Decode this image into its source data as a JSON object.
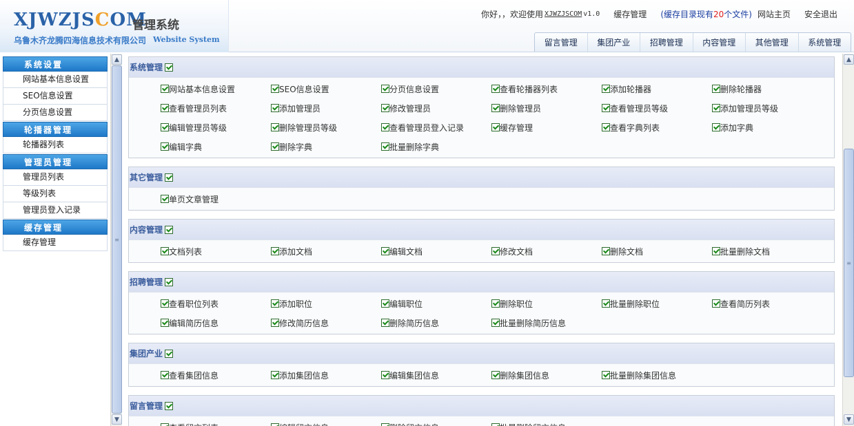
{
  "header": {
    "logo_main_a": "XJWZJS",
    "logo_main_b": "C",
    "logo_main_c": "OM",
    "logo_sub": "管理系统",
    "logo_company": "乌鲁木齐龙腾四海信息技术有限公司",
    "logo_en": "Website System"
  },
  "topbar": {
    "greeting": "你好，，欢迎使用",
    "user": "XJWZJSCOM",
    "version": "v1.0",
    "cache_link": "缓存管理",
    "cache_status_a": "(缓存目录现有",
    "cache_status_count": "20",
    "cache_status_b": "个文件)",
    "home_link": "网站主页",
    "logout_link": "安全退出"
  },
  "nav_tabs": [
    "留言管理",
    "集团产业",
    "招聘管理",
    "内容管理",
    "其他管理",
    "系统管理"
  ],
  "sidebar": [
    {
      "title": "系统设置",
      "items": [
        "网站基本信息设置",
        "SEO信息设置",
        "分页信息设置"
      ]
    },
    {
      "title": "轮播器管理",
      "items": [
        "轮播器列表"
      ]
    },
    {
      "title": "管理员管理",
      "items": [
        "管理员列表",
        "等级列表",
        "管理员登入记录"
      ]
    },
    {
      "title": "缓存管理",
      "items": [
        "缓存管理"
      ]
    }
  ],
  "sections": [
    {
      "title": "系统管理",
      "perms": [
        "网站基本信息设置",
        "SEO信息设置",
        "分页信息设置",
        "查看轮播器列表",
        "添加轮播器",
        "删除轮播器",
        "查看管理员列表",
        "添加管理员",
        "修改管理员",
        "删除管理员",
        "查看管理员等级",
        "添加管理员等级",
        "编辑管理员等级",
        "删除管理员等级",
        "查看管理员登入记录",
        "缓存管理",
        "查看字典列表",
        "添加字典",
        "编辑字典",
        "删除字典",
        "批量删除字典"
      ]
    },
    {
      "title": "其它管理",
      "perms": [
        "单页文章管理"
      ]
    },
    {
      "title": "内容管理",
      "perms": [
        "文档列表",
        "添加文档",
        "编辑文档",
        "修改文档",
        "删除文档",
        "批量删除文档"
      ]
    },
    {
      "title": "招聘管理",
      "perms": [
        "查看职位列表",
        "添加职位",
        "编辑职位",
        "删除职位",
        "批量删除职位",
        "查看简历列表",
        "编辑简历信息",
        "修改简历信息",
        "删除简历信息",
        "批量删除简历信息"
      ]
    },
    {
      "title": "集团产业",
      "perms": [
        "查看集团信息",
        "添加集团信息",
        "编辑集团信息",
        "删除集团信息",
        "批量删除集团信息"
      ]
    },
    {
      "title": "留言管理",
      "perms": [
        "查看留言列表",
        "编辑留言信息",
        "删除留言信息",
        "批量删除留言信息"
      ]
    }
  ],
  "colors": {
    "accent": "#1f78c8",
    "section_title": "#3a5c9c",
    "check": "#1a8a1a",
    "count": "#e02020"
  },
  "icons": {
    "scroll_up": "chevron-up-icon",
    "scroll_down": "chevron-down-icon",
    "checkbox": "checkmark-icon"
  }
}
